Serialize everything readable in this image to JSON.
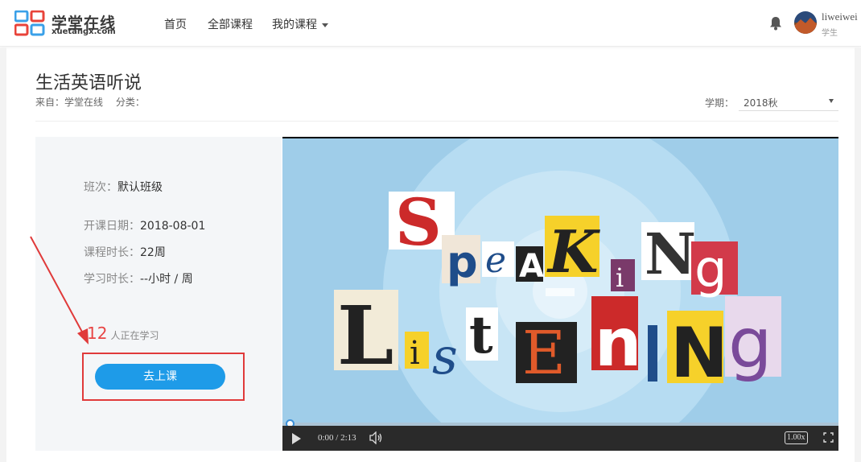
{
  "header": {
    "logo_title": "学堂在线",
    "logo_sub": "xuetangx.com",
    "nav": {
      "home": "首页",
      "all_courses": "全部课程",
      "my_courses": "我的课程"
    },
    "user": {
      "name": "liweiwei",
      "role": "学生"
    }
  },
  "course": {
    "title": "生活英语听说",
    "source": "来自：学堂在线",
    "category": "分类：",
    "term_label": "学期：",
    "term_value": "2018秋"
  },
  "info": {
    "class_label": "班次：",
    "class_value": "默认班级",
    "start_label": "开课日期：",
    "start_value": "2018-08-01",
    "duration_label": "课程时长：",
    "duration_value": "22周",
    "study_label": "学习时长：",
    "study_value": "--小时 / 周",
    "learning_count": "12",
    "learning_text": "人正在学习",
    "go_button": "去上课"
  },
  "video": {
    "time": "0:00 / 2:13",
    "speed": "1.00x",
    "progress": 0.0
  },
  "colors": {
    "accent": "#1e9be8",
    "highlight": "#e03a3a",
    "count": "#e84545"
  }
}
